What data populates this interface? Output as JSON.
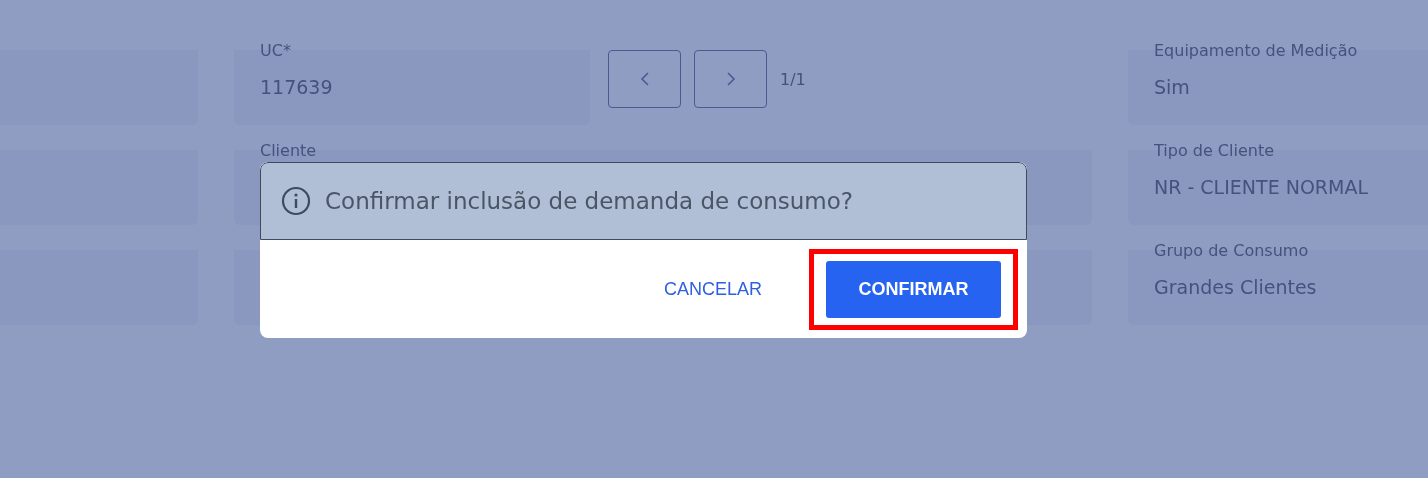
{
  "uc_field": {
    "label": "UC*",
    "value": "117639"
  },
  "pagination": {
    "counter": "1/1"
  },
  "client_field": {
    "label": "Cliente"
  },
  "right_fields": [
    {
      "label": "Equipamento de Medição",
      "value": "Sim"
    },
    {
      "label": "Tipo de Cliente",
      "value": "NR - CLIENTE NORMAL"
    },
    {
      "label": "Grupo de Consumo",
      "value": "Grandes Clientes"
    }
  ],
  "dialog": {
    "message": "Confirmar inclusão de demanda de consumo?",
    "buttons": [
      {
        "label": "CANCELAR",
        "kind": "text",
        "highlighted": false
      },
      {
        "label": "CONFIRMAR",
        "kind": "primary",
        "highlighted": true
      }
    ]
  }
}
